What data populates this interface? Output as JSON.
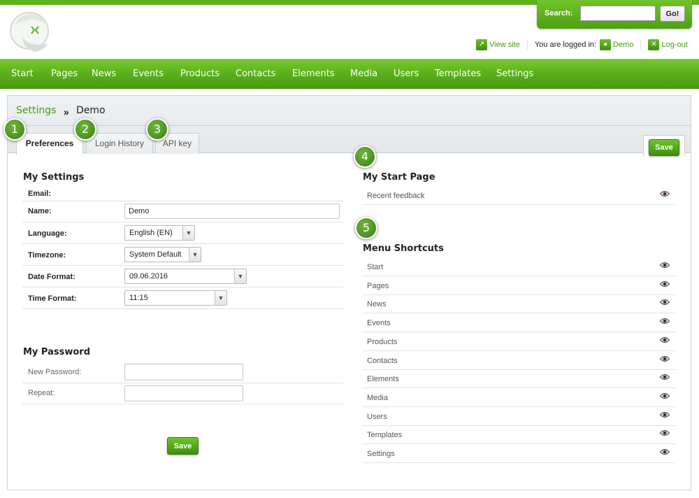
{
  "header": {
    "search_label": "Search:",
    "search_value": "",
    "go_label": "Go!",
    "view_site": "View site",
    "logged_in_text": "You are logged in:",
    "user_name": "Demo",
    "logout": "Log-out"
  },
  "nav": [
    "Start",
    "Pages",
    "News",
    "Events",
    "Products",
    "Contacts",
    "Elements",
    "Media",
    "Users",
    "Templates",
    "Settings"
  ],
  "breadcrumb": {
    "parent": "Settings",
    "separator": "»",
    "current": "Demo"
  },
  "tabs": [
    "Preferences",
    "Login History",
    "API key"
  ],
  "badges": [
    "1",
    "2",
    "3",
    "4",
    "5"
  ],
  "save_label": "Save",
  "my_settings": {
    "title": "My Settings",
    "email_label": "Email:",
    "name_label": "Name:",
    "name_value": "Demo",
    "language_label": "Language:",
    "language_value": "English (EN)",
    "timezone_label": "Timezone:",
    "timezone_value": "System Default",
    "date_format_label": "Date Format:",
    "date_format_value": "09.06.2016",
    "time_format_label": "Time Format:",
    "time_format_value": "11:15"
  },
  "my_password": {
    "title": "My Password",
    "new_password_label": "New Password:",
    "repeat_label": "Repeat:"
  },
  "start_page": {
    "title": "My Start Page",
    "items": [
      "Recent feedback"
    ]
  },
  "menu_shortcuts": {
    "title": "Menu Shortcuts",
    "items": [
      "Start",
      "Pages",
      "News",
      "Events",
      "Products",
      "Contacts",
      "Elements",
      "Media",
      "Users",
      "Templates",
      "Settings"
    ]
  },
  "colors": {
    "brand_green": "#5ab01b",
    "link_green": "#4a9a12"
  }
}
